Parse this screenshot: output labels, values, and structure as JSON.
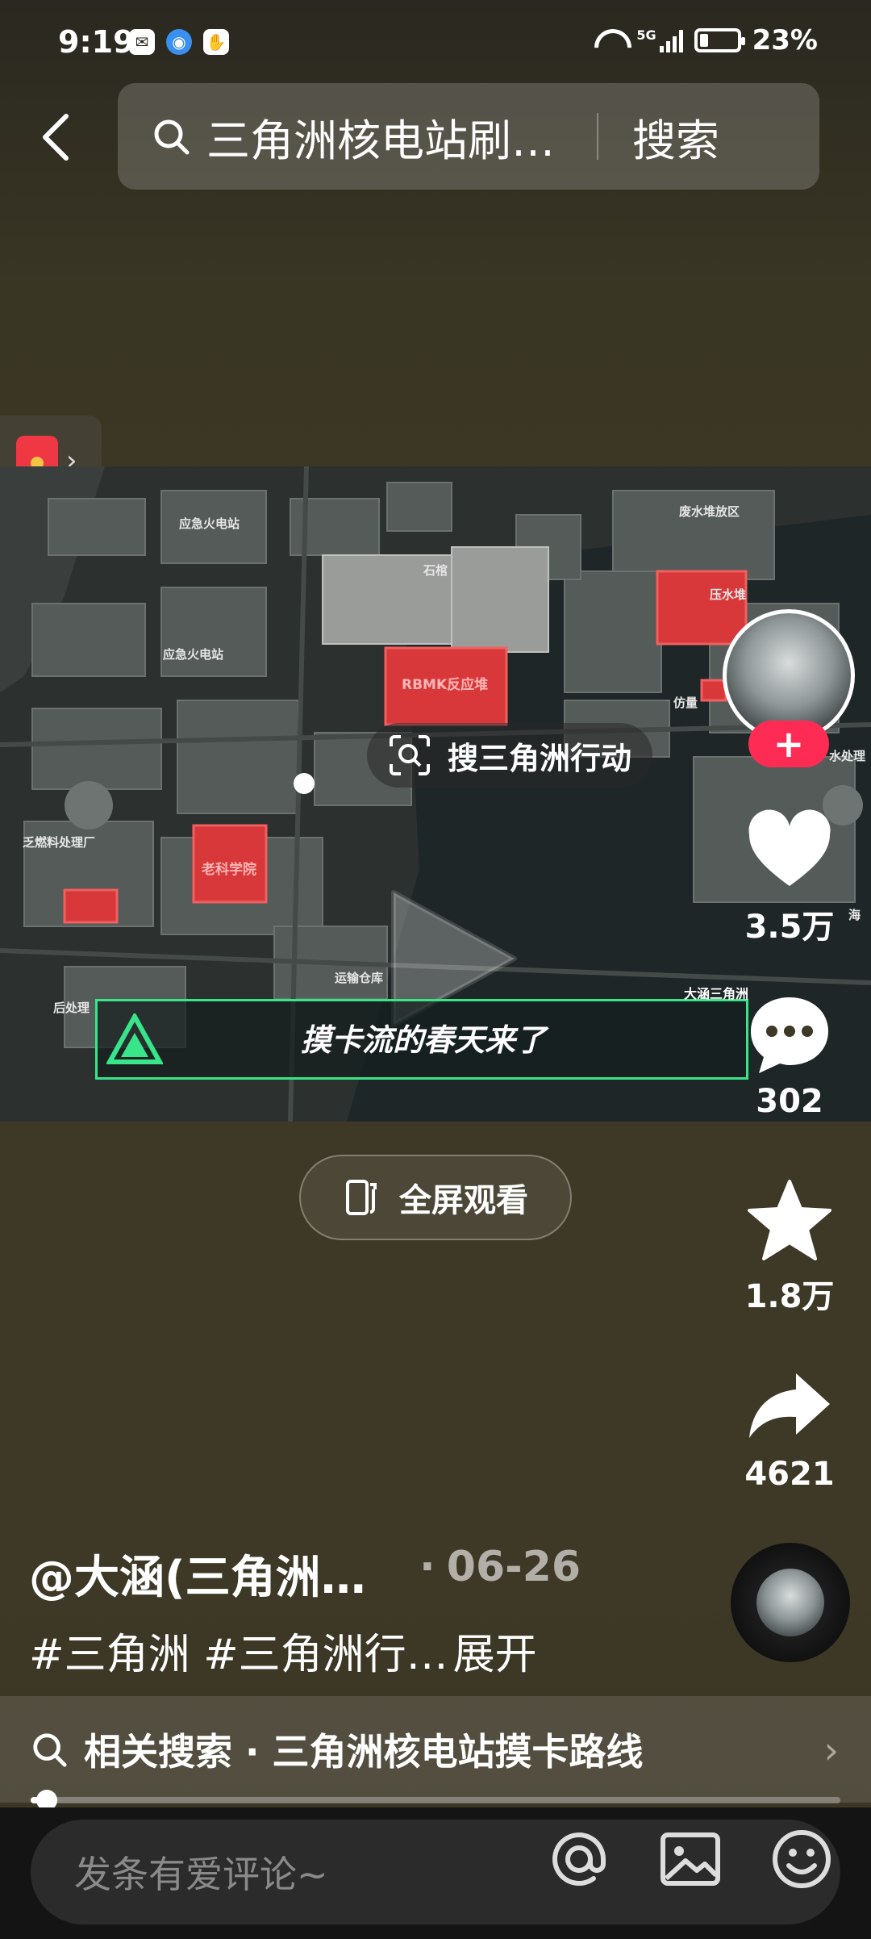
{
  "status_bar": {
    "time": "9:19",
    "network": "5G",
    "battery": "23%",
    "battery_level": 0.23
  },
  "header": {
    "search_query": "三角洲核电站刷…",
    "search_button": "搜索"
  },
  "video": {
    "search_pill": "搜三角洲行动",
    "banner_text": "摸卡流的春天来了",
    "banner_author": "大涵三角洲",
    "map_labels": {
      "l1": "应急火电站",
      "l2": "石棺",
      "l3": "废水堆放区",
      "l4": "压水堆",
      "l5": "应急火电站",
      "l6": "RBMK反应堆",
      "l7": "仿量",
      "l8": "乏燃料处理厂",
      "l9": "老科学院",
      "l10": "水处理",
      "l11": "海",
      "l12": "运输仓库",
      "l13": "后处理"
    }
  },
  "fullscreen": {
    "label": "全屏观看"
  },
  "actions": {
    "likes": "3.5万",
    "comments": "302",
    "favorites": "1.8万",
    "shares": "4621"
  },
  "post": {
    "author": "@大涵(三角洲…",
    "separator": "·",
    "date": "06-26",
    "caption": "#三角洲 #三角洲行…",
    "expand": "展开"
  },
  "related": {
    "label": "相关搜索 · 三角洲核电站摸卡路线"
  },
  "progress": {
    "fraction": 0.02
  },
  "comment": {
    "placeholder": "发条有爱评论~"
  },
  "colors": {
    "accent_red": "#fe2c55",
    "map_red": "#e8383c",
    "banner_green": "#38e58a"
  },
  "icons": [
    "back-icon",
    "search-icon",
    "red-packet-icon",
    "scan-icon",
    "play-icon",
    "heart-icon",
    "comment-icon",
    "star-icon",
    "share-icon",
    "fullscreen-icon",
    "at-icon",
    "image-icon",
    "emoji-icon"
  ]
}
